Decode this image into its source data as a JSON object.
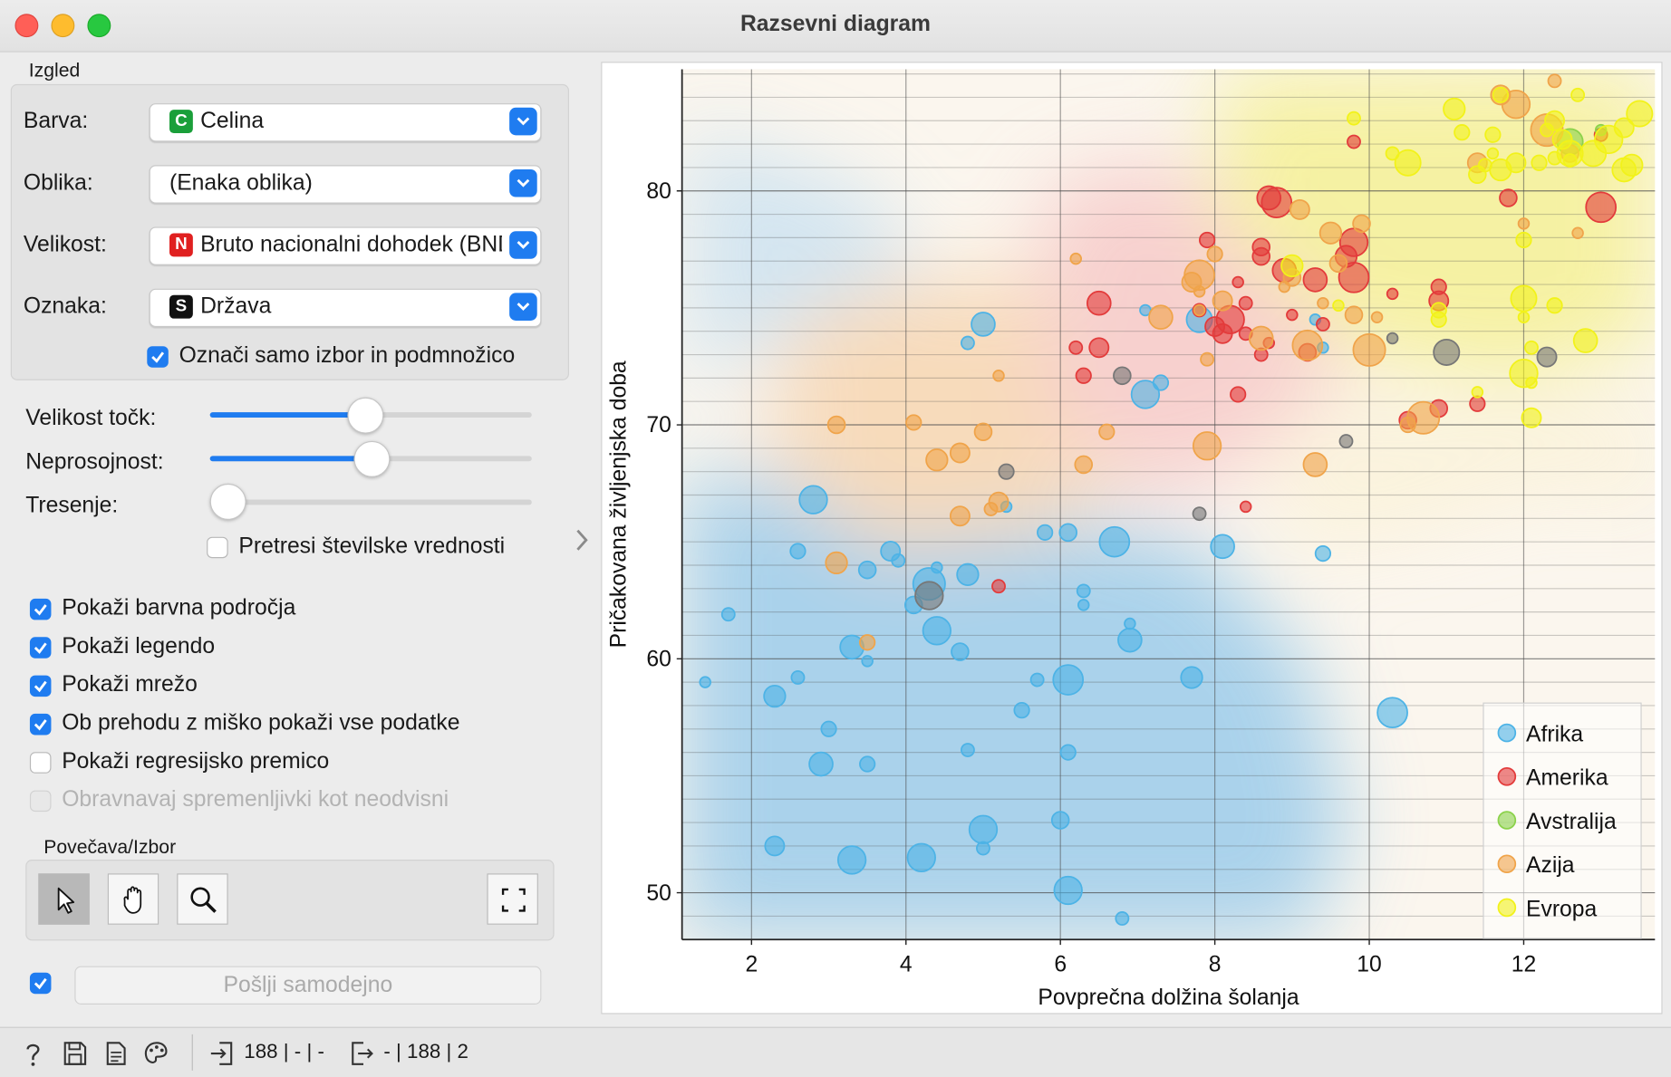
{
  "window": {
    "title": "Razsevni diagram"
  },
  "appearance": {
    "group_label": "Izgled",
    "color": {
      "label": "Barva:",
      "badge": "C",
      "badge_color": "#1a9f3a",
      "value": "Celina"
    },
    "shape": {
      "label": "Oblika:",
      "value": "(Enaka oblika)"
    },
    "size": {
      "label": "Velikost:",
      "badge": "N",
      "badge_color": "#e02020",
      "value": "Bruto nacionalni dohodek (BND)"
    },
    "label_attr": {
      "label": "Oznaka:",
      "badge": "S",
      "badge_color": "#111111",
      "value": "Država"
    },
    "label_only_selected": {
      "label": "Označi samo izbor in podmnožico",
      "checked": true
    }
  },
  "sliders": {
    "point_size": {
      "label": "Velikost točk:",
      "fraction": 0.48
    },
    "opacity": {
      "label": "Neprosojnost:",
      "fraction": 0.5
    },
    "jitter": {
      "label": "Tresenje:",
      "fraction": 0.0
    },
    "jitter_numeric": {
      "label": "Pretresi številske vrednosti",
      "checked": false
    }
  },
  "options": [
    {
      "label": "Pokaži barvna področja",
      "checked": true,
      "enabled": true
    },
    {
      "label": "Pokaži legendo",
      "checked": true,
      "enabled": true
    },
    {
      "label": "Pokaži mrežo",
      "checked": true,
      "enabled": true
    },
    {
      "label": "Ob prehodu z miško pokaži vse podatke",
      "checked": true,
      "enabled": true
    },
    {
      "label": "Pokaži regresijsko premico",
      "checked": false,
      "enabled": true
    },
    {
      "label": "Obravnavaj spremenljivki kot neodvisni",
      "checked": false,
      "enabled": false
    }
  ],
  "zoom": {
    "group_label": "Povečava/Izbor",
    "tools": [
      "select-pointer-icon",
      "pan-hand-icon",
      "zoom-magnifier-icon"
    ],
    "reset_icon": "fit-to-view-icon"
  },
  "send": {
    "auto_checked": true,
    "label": "Pošlji samodejno"
  },
  "status": {
    "input": "188 | - | -",
    "output": "- | 188 | 2"
  },
  "chart_data": {
    "type": "scatter",
    "xlabel": "Povprečna dolžina šolanja",
    "ylabel": "Pričakovana življenjska doba",
    "xlim": [
      1.1,
      13.7
    ],
    "ylim": [
      48,
      85.2
    ],
    "xticks": [
      2,
      4,
      6,
      8,
      10,
      12
    ],
    "yticks": [
      50,
      60,
      70,
      80
    ],
    "grid": true,
    "legend_position": "bottom-right",
    "legend": [
      {
        "name": "Afrika",
        "color": "#4db3e6"
      },
      {
        "name": "Amerika",
        "color": "#e33b3b"
      },
      {
        "name": "Avstralija",
        "color": "#8bd24a"
      },
      {
        "name": "Azija",
        "color": "#f0a44a"
      },
      {
        "name": "Evropa",
        "color": "#f2f21a"
      }
    ],
    "series": [
      {
        "name": "Afrika",
        "color": "#4db3e6",
        "points": [
          [
            1.4,
            59
          ],
          [
            1.7,
            61.9
          ],
          [
            2.3,
            58.4
          ],
          [
            2.3,
            52
          ],
          [
            2.6,
            64.6
          ],
          [
            2.6,
            59.2
          ],
          [
            2.8,
            66.8
          ],
          [
            2.9,
            55.5
          ],
          [
            3.0,
            57
          ],
          [
            3.3,
            60.5
          ],
          [
            3.3,
            51.4
          ],
          [
            3.5,
            63.8
          ],
          [
            3.5,
            59.9
          ],
          [
            3.5,
            55.5
          ],
          [
            3.8,
            64.6
          ],
          [
            3.9,
            64.2
          ],
          [
            4.1,
            62.3
          ],
          [
            4.2,
            51.5
          ],
          [
            4.3,
            63.2
          ],
          [
            4.4,
            61.2
          ],
          [
            4.4,
            63.9
          ],
          [
            4.7,
            60.3
          ],
          [
            4.8,
            63.6
          ],
          [
            4.8,
            56.1
          ],
          [
            5.0,
            52.7
          ],
          [
            5.0,
            51.9
          ],
          [
            4.8,
            73.5
          ],
          [
            5.0,
            74.3
          ],
          [
            5.3,
            66.5
          ],
          [
            5.5,
            57.8
          ],
          [
            5.7,
            59.1
          ],
          [
            5.8,
            65.4
          ],
          [
            6.0,
            53.1
          ],
          [
            6.1,
            65.4
          ],
          [
            6.1,
            59.1
          ],
          [
            6.1,
            56
          ],
          [
            6.1,
            50.1
          ],
          [
            6.3,
            62.9
          ],
          [
            6.3,
            62.3
          ],
          [
            6.7,
            65
          ],
          [
            6.8,
            48.9
          ],
          [
            6.9,
            61.5
          ],
          [
            6.9,
            60.8
          ],
          [
            7.1,
            74.9
          ],
          [
            7.1,
            71.3
          ],
          [
            7.3,
            71.8
          ],
          [
            7.7,
            59.2
          ],
          [
            7.8,
            74.5
          ],
          [
            8.1,
            64.8
          ],
          [
            9.3,
            74.5
          ],
          [
            9.4,
            64.5
          ],
          [
            9.4,
            73.3
          ],
          [
            10.3,
            57.7
          ]
        ]
      },
      {
        "name": "Amerika",
        "color": "#e33b3b",
        "points": [
          [
            5.2,
            63.1
          ],
          [
            6.2,
            73.3
          ],
          [
            6.3,
            72.1
          ],
          [
            6.5,
            75.2
          ],
          [
            6.5,
            73.3
          ],
          [
            7.8,
            74.9
          ],
          [
            7.9,
            77.9
          ],
          [
            8.0,
            74.2
          ],
          [
            8.1,
            73.9
          ],
          [
            8.2,
            74.5
          ],
          [
            8.3,
            71.3
          ],
          [
            8.3,
            76.1
          ],
          [
            8.4,
            66.5
          ],
          [
            8.4,
            73.9
          ],
          [
            8.4,
            75.2
          ],
          [
            8.6,
            77.6
          ],
          [
            8.6,
            77.2
          ],
          [
            8.6,
            73
          ],
          [
            8.7,
            79.7
          ],
          [
            8.7,
            73.5
          ],
          [
            8.8,
            79.5
          ],
          [
            8.9,
            76.6
          ],
          [
            9.0,
            74.7
          ],
          [
            9.2,
            73.1
          ],
          [
            9.3,
            76.2
          ],
          [
            9.4,
            74.3
          ],
          [
            9.7,
            77.2
          ],
          [
            9.8,
            82.1
          ],
          [
            9.8,
            77.8
          ],
          [
            9.8,
            76.3
          ],
          [
            10.3,
            75.6
          ],
          [
            10.5,
            70.2
          ],
          [
            10.9,
            75.9
          ],
          [
            10.9,
            75.3
          ],
          [
            10.9,
            70.7
          ],
          [
            11.4,
            70.9
          ],
          [
            11.8,
            79.7
          ],
          [
            13.0,
            82.4
          ],
          [
            13.0,
            79.3
          ]
        ]
      },
      {
        "name": "Avstralija",
        "color": "#8bd24a",
        "points": [
          [
            12.6,
            82.1
          ],
          [
            13.0,
            82.6
          ]
        ]
      },
      {
        "name": "Azija",
        "color": "#f0a44a",
        "points": [
          [
            3.1,
            70
          ],
          [
            3.1,
            64.1
          ],
          [
            3.5,
            60.7
          ],
          [
            4.1,
            70.1
          ],
          [
            4.4,
            68.5
          ],
          [
            4.7,
            68.8
          ],
          [
            4.7,
            66.1
          ],
          [
            5.0,
            69.7
          ],
          [
            5.1,
            66.4
          ],
          [
            5.2,
            66.7
          ],
          [
            5.2,
            72.1
          ],
          [
            6.2,
            77.1
          ],
          [
            6.3,
            68.3
          ],
          [
            6.6,
            69.7
          ],
          [
            7.3,
            74.6
          ],
          [
            7.7,
            76.1
          ],
          [
            7.8,
            74.9
          ],
          [
            7.8,
            76.4
          ],
          [
            7.8,
            75.7
          ],
          [
            7.9,
            72.8
          ],
          [
            7.9,
            69.1
          ],
          [
            8.0,
            77.3
          ],
          [
            8.1,
            75.3
          ],
          [
            8.6,
            73.7
          ],
          [
            8.9,
            75.9
          ],
          [
            9.0,
            76.3
          ],
          [
            9.1,
            79.2
          ],
          [
            9.2,
            73.4
          ],
          [
            9.3,
            68.3
          ],
          [
            9.4,
            75.2
          ],
          [
            9.5,
            78.2
          ],
          [
            9.6,
            76.9
          ],
          [
            9.8,
            74.7
          ],
          [
            9.9,
            78.6
          ],
          [
            10.0,
            73.2
          ],
          [
            10.1,
            74.6
          ],
          [
            10.5,
            70
          ],
          [
            10.7,
            70.3
          ],
          [
            11.4,
            81.2
          ],
          [
            11.7,
            84.1
          ],
          [
            11.9,
            83.7
          ],
          [
            12.0,
            78.6
          ],
          [
            12.4,
            84.7
          ],
          [
            12.3,
            82.6
          ],
          [
            12.6,
            81.6
          ],
          [
            12.7,
            78.2
          ]
        ]
      },
      {
        "name": "Evropa",
        "color": "#f2f21a",
        "points": [
          [
            9.0,
            76.8
          ],
          [
            9.6,
            75.1
          ],
          [
            9.8,
            83.1
          ],
          [
            10.3,
            81.6
          ],
          [
            10.5,
            81.2
          ],
          [
            10.9,
            74.9
          ],
          [
            10.9,
            74.5
          ],
          [
            11.1,
            83.5
          ],
          [
            11.2,
            82.5
          ],
          [
            11.4,
            80.7
          ],
          [
            11.4,
            71.4
          ],
          [
            11.5,
            81.1
          ],
          [
            11.6,
            81.6
          ],
          [
            11.6,
            82.4
          ],
          [
            11.7,
            80.9
          ],
          [
            11.7,
            84.1
          ],
          [
            11.9,
            81.2
          ],
          [
            12.0,
            77.9
          ],
          [
            12.0,
            74.6
          ],
          [
            12.0,
            72.2
          ],
          [
            12.1,
            73.3
          ],
          [
            12.0,
            75.4
          ],
          [
            12.1,
            70.3
          ],
          [
            12.1,
            71.8
          ],
          [
            12.2,
            81.2
          ],
          [
            12.3,
            82.6
          ],
          [
            12.4,
            81.4
          ],
          [
            12.4,
            75.1
          ],
          [
            12.4,
            83
          ],
          [
            12.5,
            82.2
          ],
          [
            12.6,
            81.3
          ],
          [
            12.6,
            81.6
          ],
          [
            12.7,
            84.1
          ],
          [
            12.8,
            73.6
          ],
          [
            12.9,
            81.6
          ],
          [
            13.1,
            82.2
          ],
          [
            13.3,
            80.9
          ],
          [
            13.3,
            82.7
          ],
          [
            13.4,
            81.1
          ],
          [
            13.5,
            83.3
          ]
        ]
      },
      {
        "name": "",
        "color": "#777777",
        "points": [
          [
            4.3,
            62.7
          ],
          [
            5.3,
            68
          ],
          [
            6.8,
            72.1
          ],
          [
            7.8,
            66.2
          ],
          [
            9.7,
            69.3
          ],
          [
            10.3,
            73.7
          ],
          [
            11.0,
            73.1
          ],
          [
            12.3,
            72.9
          ]
        ]
      }
    ]
  }
}
